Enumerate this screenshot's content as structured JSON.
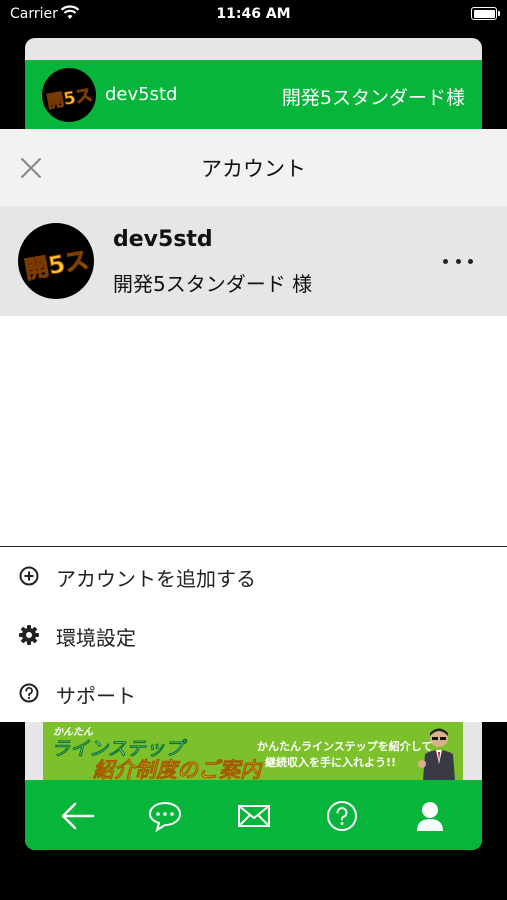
{
  "status_bar": {
    "carrier": "Carrier",
    "time": "11:46 AM"
  },
  "background": {
    "username": "dev5std",
    "fullname": "開発5スタンダード様",
    "avatar_text": "開5ス"
  },
  "banner": {
    "tag": "かんたん",
    "title_line1": "ラインステップ",
    "title_line2": "紹介制度のご案内",
    "desc_line1": "かんたんラインステップを紹介して",
    "desc_line2": "継続収入を手に入れよう!!"
  },
  "sheet": {
    "title": "アカウント",
    "account": {
      "username": "dev5std",
      "fullname": "開発5スタンダード 様",
      "avatar_text": "開5ス"
    },
    "menu": [
      {
        "label": "アカウントを追加する",
        "icon": "plus-circle-icon"
      },
      {
        "label": "環境設定",
        "icon": "gear-icon"
      },
      {
        "label": "サポート",
        "icon": "question-circle-icon"
      }
    ]
  },
  "tab_bar": {
    "items": [
      {
        "icon": "back-arrow-icon"
      },
      {
        "icon": "chat-bubble-icon"
      },
      {
        "icon": "mail-icon"
      },
      {
        "icon": "help-icon"
      },
      {
        "icon": "user-icon"
      }
    ]
  },
  "colors": {
    "brand_green": "#07b53b",
    "sheet_header": "#f2f2f2",
    "selected_row": "#e6e6e6"
  }
}
